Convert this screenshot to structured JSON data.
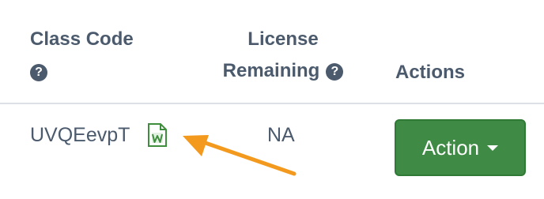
{
  "table": {
    "headers": {
      "class_code": "Class Code",
      "license_line1": "License",
      "license_line2": "Remaining",
      "actions": "Actions",
      "help_glyph": "?"
    },
    "rows": [
      {
        "class_code": "UVQEevpT",
        "license_remaining": "NA",
        "action_label": "Action",
        "doc_icon": "word-document-icon"
      }
    ]
  },
  "icons": {
    "help": "question-circle-icon",
    "document": "word-document-icon",
    "dropdown": "caret-down-icon",
    "annotation": "arrow-icon"
  },
  "colors": {
    "header_text": "#4b5a6c",
    "action_button": "#3f8a44",
    "doc_icon": "#3e8e3e",
    "annotation_arrow": "#f39a1e",
    "divider": "#dde1e5"
  }
}
